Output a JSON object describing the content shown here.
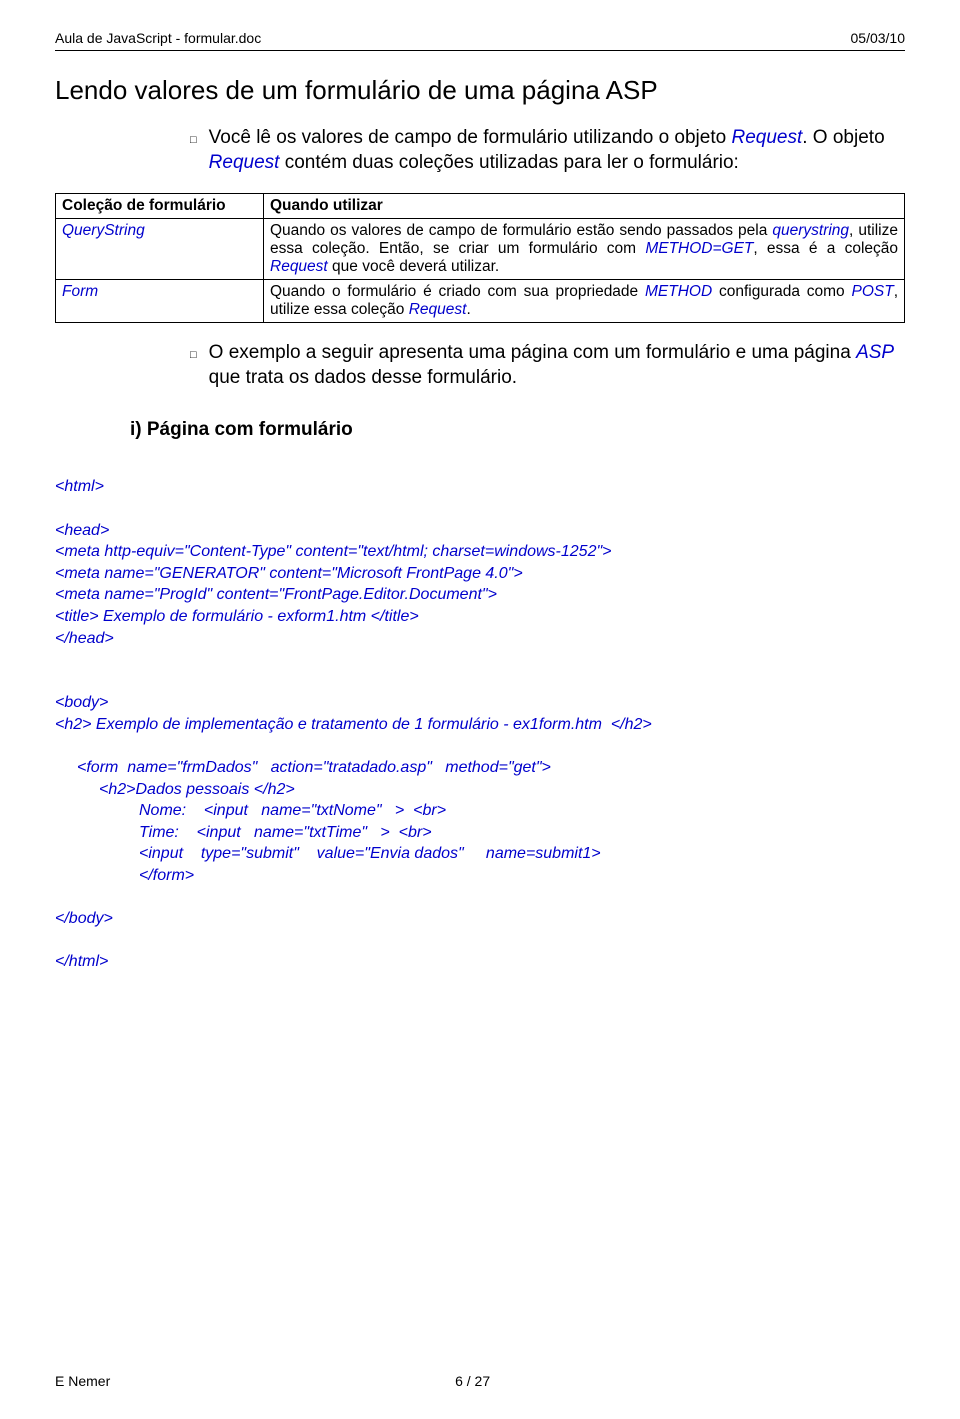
{
  "header": {
    "left": "Aula de JavaScript - formular.doc",
    "right": "05/03/10"
  },
  "title": "Lendo valores de um formulário de uma página ASP",
  "bullet1": {
    "pre": "Você lê os valores de campo de formulário utilizando o objeto ",
    "term1": "Request",
    "mid": ". O objeto ",
    "term2": "Request",
    "post": " contém duas coleções utilizadas para ler o formulário:"
  },
  "table": {
    "h1": "Coleção de formulário",
    "h2": "Quando utilizar",
    "r1c1": "QueryString",
    "r1c2_pre": "Quando os valores de campo de formulário estão sendo passados pela ",
    "r1c2_qs": "querystring",
    "r1c2_mid1": ", utilize essa coleção. Então, se criar um formulário com ",
    "r1c2_mg": "METHOD=GET",
    "r1c2_mid2": ", essa é a  coleção ",
    "r1c2_req": "Request",
    "r1c2_post": " que você deverá utilizar.",
    "r2c1": "Form",
    "r2c2_pre": "Quando o formulário é criado com sua propriedade ",
    "r2c2_m": "METHOD",
    "r2c2_mid1": " configurada como ",
    "r2c2_p": "POST",
    "r2c2_mid2": ", utilize essa coleção ",
    "r2c2_req": "Request",
    "r2c2_post": "."
  },
  "bullet2": {
    "pre": "O exemplo a seguir apresenta uma página com um formulário e uma página ",
    "asp": "ASP",
    "post": " que trata os dados desse formulário."
  },
  "sub": "i)  Página com formulário",
  "code": {
    "l1": "<html>",
    "l2": "<head>",
    "l3": "<meta http-equiv=\"Content-Type\" content=\"text/html; charset=windows-1252\">",
    "l4": "<meta name=\"GENERATOR\" content=\"Microsoft FrontPage 4.0\">",
    "l5": "<meta name=\"ProgId\" content=\"FrontPage.Editor.Document\">",
    "l6": "<title> Exemplo de formulário - exform1.htm </title>",
    "l7": "</head>",
    "l8": "<body>",
    "l9": "<h2> Exemplo de implementação e tratamento de 1 formulário - ex1form.htm  </h2>",
    "l10": "<form  name=\"frmDados\"   action=\"tratadado.asp\"   method=\"get\">",
    "l11": "<h2>Dados pessoais </h2>",
    "l12": "Nome:    <input   name=\"txtNome\"   >  <br>",
    "l13": "Time:    <input   name=\"txtTime\"   >  <br>",
    "l14": "<input    type=\"submit\"    value=\"Envia dados\"     name=submit1>",
    "l15": "</form>",
    "l16": "</body>",
    "l17": "</html>"
  },
  "footer": {
    "left": "E Nemer",
    "center": "6 / 27"
  }
}
